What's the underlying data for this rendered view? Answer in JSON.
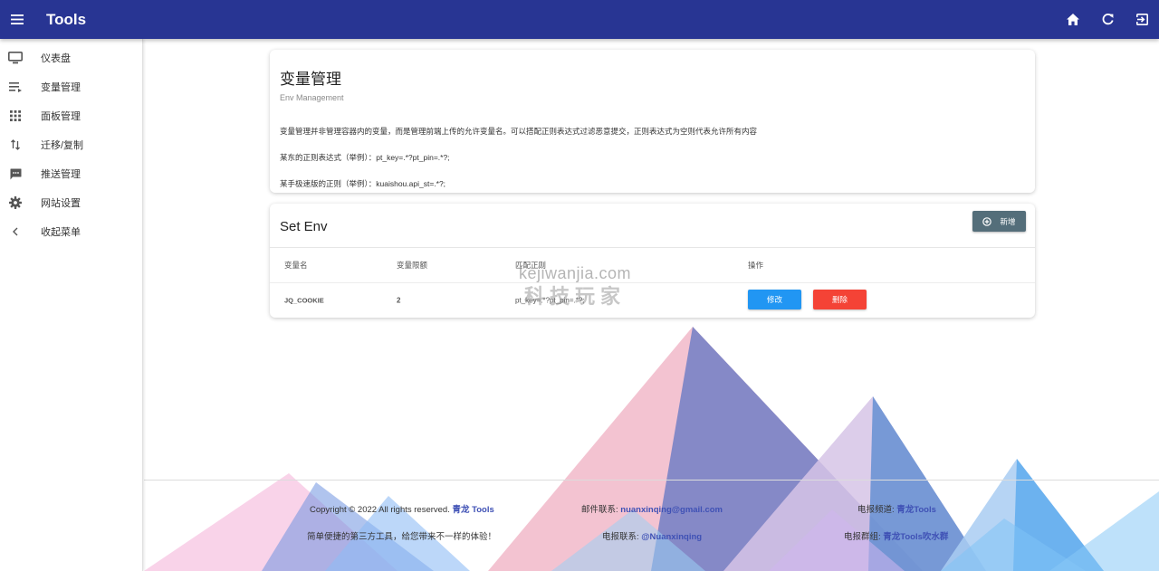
{
  "app": {
    "title": "Tools"
  },
  "sidebar": {
    "items": [
      {
        "label": "仪表盘",
        "icon": "monitor-icon"
      },
      {
        "label": "变量管理",
        "icon": "playlist-icon"
      },
      {
        "label": "面板管理",
        "icon": "apps-grid-icon"
      },
      {
        "label": "迁移/复制",
        "icon": "swap-vertical-icon"
      },
      {
        "label": "推送管理",
        "icon": "message-icon"
      },
      {
        "label": "网站设置",
        "icon": "gear-icon"
      },
      {
        "label": "收起菜单",
        "icon": "chevron-left-icon"
      }
    ]
  },
  "info_card": {
    "title": "变量管理",
    "subtitle": "Env Management",
    "desc": "变量管理并非管理容器内的变量，而是管理前端上传的允许变量名。可以搭配正则表达式过滤恶意提交，正则表达式为空则代表允许所有内容",
    "example1": "某东的正则表达式（举例）：pt_key=.*?pt_pin=.*?;",
    "example2": "某手极速版的正则（举例）：kuaishou.api_st=.*?;"
  },
  "env_card": {
    "title": "Set Env",
    "add_label": "新增",
    "columns": [
      "变量名",
      "变量限额",
      "匹配正则",
      "操作"
    ],
    "rows": [
      {
        "name": "JQ_COOKIE",
        "limit": "2",
        "regex": "pt_key=.*?pt_pin=.*?;",
        "edit_label": "修改",
        "delete_label": "删除"
      }
    ]
  },
  "watermark": {
    "en": "kejiwanjia.com",
    "cn": "科技玩家"
  },
  "footer": {
    "copyright": "Copyright © 2022 All rights reserved.",
    "brand": "青龙 Tools",
    "email_label": "邮件联系:",
    "email": "nuanxinqing@gmail.com",
    "channel_label": "电报频道:",
    "channel": "青龙Tools",
    "slogan": "简单便捷的第三方工具，给您带来不一样的体验！",
    "tg_label": "电报联系:",
    "tg": "@Nuanxinqing",
    "group_label": "电报群组:",
    "group": "青龙Tools吹水群"
  },
  "colors": {
    "appbar": "#283593",
    "add_button": "#546e7a",
    "edit_button": "#2196f3",
    "delete_button": "#f44336",
    "link": "#3f51b5"
  }
}
